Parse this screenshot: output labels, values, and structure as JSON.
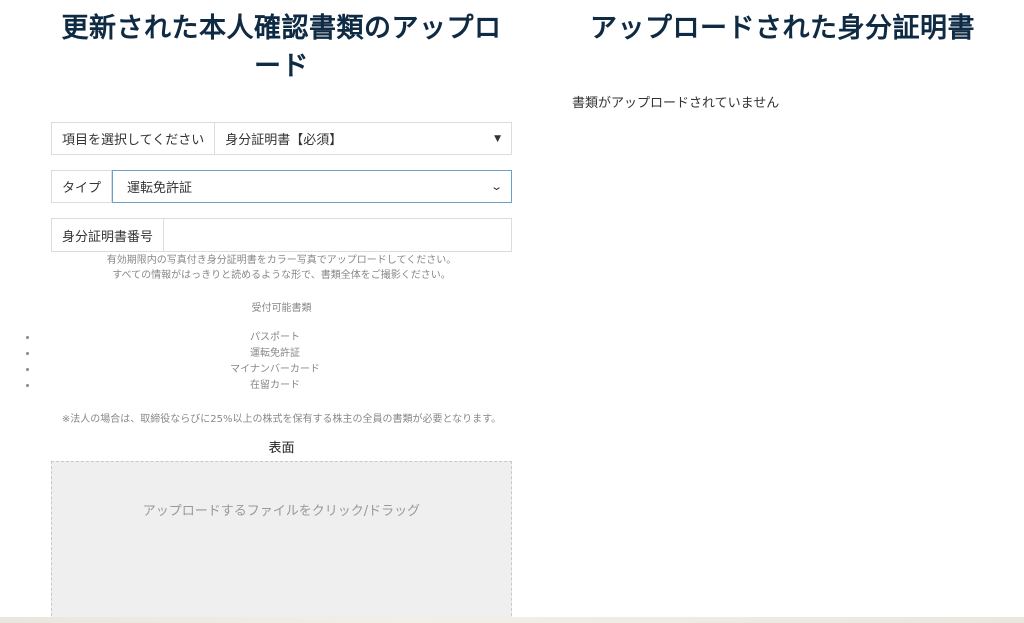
{
  "upload_section": {
    "title": "更新された本人確認書類のアップロード",
    "category_label": "項目を選択してください",
    "category_value": "身分証明書【必須】",
    "type_label": "タイプ",
    "type_value": "運転免許証",
    "id_number_label": "身分証明書番号",
    "id_number_value": "",
    "helper_line1": "有効期限内の写真付き身分証明書をカラー写真でアップロードしてください。",
    "helper_line2": "すべての情報がはっきりと読めるような形で、書類全体をご撮影ください。",
    "accepted_title": "受付可能書類",
    "accepted_docs": [
      "パスポート",
      "運転免許証",
      "マイナンバーカード",
      "在留カード"
    ],
    "corporate_note": "※法人の場合は、取締役ならびに25%以上の株式を保有する株主の全員の書類が必要となります。",
    "front_label": "表面",
    "dropzone_text": "アップロードするファイルをクリック/ドラッグ"
  },
  "uploaded_section": {
    "title": "アップロードされた身分証明書",
    "empty_text": "書類がアップロードされていません"
  },
  "icons": {
    "select_caret": "caret-down-icon",
    "type_chevron": "chevron-down-icon"
  },
  "colors": {
    "title": "#0f2a43",
    "focus_border": "#6aa0c9",
    "dropzone_bg": "#efefef"
  }
}
